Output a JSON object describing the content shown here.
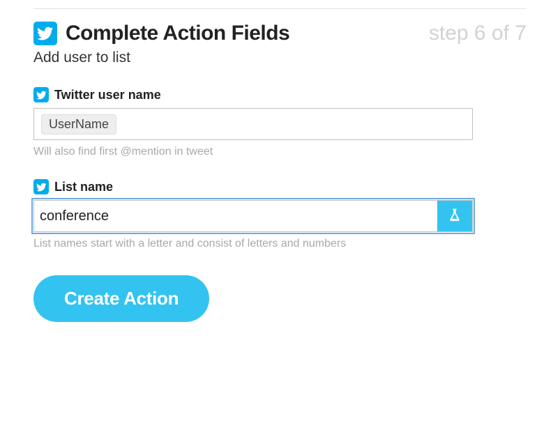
{
  "header": {
    "title": "Complete Action Fields",
    "step_indicator": "step 6 of 7",
    "subtitle": "Add user to list"
  },
  "fields": {
    "username": {
      "label": "Twitter user name",
      "chip_value": "UserName",
      "hint": "Will also find first @mention in tweet"
    },
    "listname": {
      "label": "List name",
      "value": "conference",
      "hint": "List names start with a letter and consist of letters and numbers"
    }
  },
  "buttons": {
    "create_action": "Create Action"
  },
  "icons": {
    "twitter": "twitter-bird",
    "flask": "beaker"
  },
  "colors": {
    "accent": "#33c3f0",
    "twitter": "#00aced",
    "focus_outline": "#6fa9e2"
  }
}
